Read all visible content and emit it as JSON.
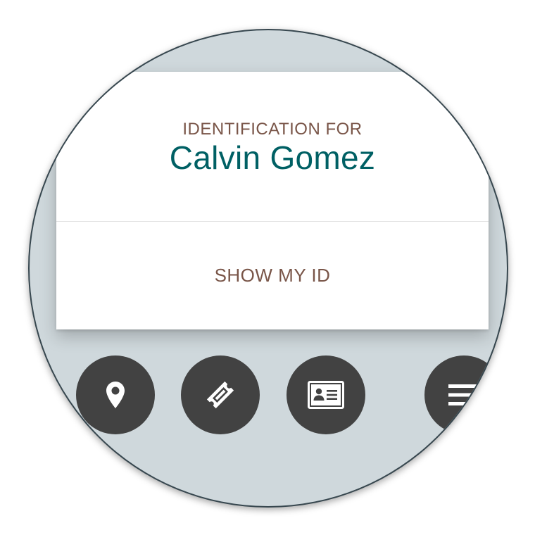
{
  "card": {
    "kicker": "IDENTIFICATION FOR",
    "name": "Calvin Gomez",
    "action_label": "SHOW MY ID"
  },
  "nav": {
    "items": [
      {
        "icon": "map-marker-icon"
      },
      {
        "icon": "ticket-icon"
      },
      {
        "icon": "id-card-icon"
      },
      {
        "icon": "menu-icon"
      }
    ]
  },
  "colors": {
    "background": "#cfd8dc",
    "card": "#ffffff",
    "kicker_text": "#795548",
    "name_text": "#006064",
    "nav_button": "#424242",
    "nav_icon": "#ffffff"
  }
}
